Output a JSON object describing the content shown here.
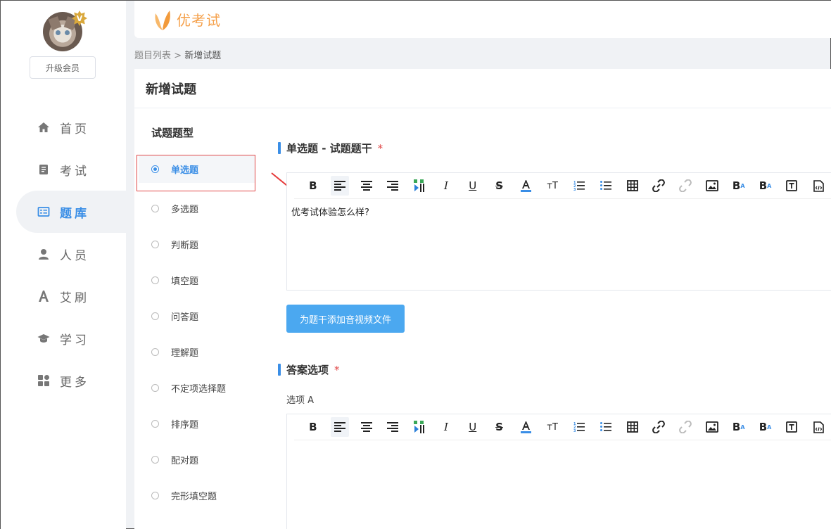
{
  "app": {
    "name": "优考试",
    "accent": "#3a8ee6",
    "logo_color": "#f5a04a"
  },
  "user": {
    "vip_badge": "V",
    "upgrade_label": "升级会员"
  },
  "sidebar": {
    "items": [
      {
        "label": "首页",
        "icon": "home-icon"
      },
      {
        "label": "考试",
        "icon": "exam-book-icon"
      },
      {
        "label": "题库",
        "icon": "question-bank-icon",
        "active": true
      },
      {
        "label": "人员",
        "icon": "person-icon"
      },
      {
        "label": "艾刷",
        "icon": "a-letter-icon"
      },
      {
        "label": "学习",
        "icon": "graduation-cap-icon"
      },
      {
        "label": "更多",
        "icon": "grid-more-icon"
      }
    ]
  },
  "breadcrumb": {
    "parent": "题目列表",
    "separator": ">",
    "current": "新增试题"
  },
  "page": {
    "title": "新增试题"
  },
  "question_types": {
    "heading": "试题题型",
    "items": [
      "单选题",
      "多选题",
      "判断题",
      "填空题",
      "问答题",
      "理解题",
      "不定项选择题",
      "排序题",
      "配对题",
      "完形填空题"
    ],
    "selected": "单选题"
  },
  "stem_section": {
    "title": "单选题 - 试题题干",
    "required_mark": "*",
    "content": "优考试体验怎么样?",
    "media_button": "为题干添加音视频文件"
  },
  "answer_section": {
    "title": "答案选项",
    "required_mark": "*",
    "option_a_label": "选项 A"
  },
  "toolbar_tools": [
    "bold",
    "align-left",
    "align-center",
    "align-right",
    "format-paint",
    "italic",
    "underline",
    "strikethrough",
    "font-color",
    "font-size",
    "ordered-list",
    "unordered-list",
    "table",
    "link",
    "unlink",
    "image",
    "superscript",
    "subscript",
    "text-box",
    "source-code"
  ]
}
